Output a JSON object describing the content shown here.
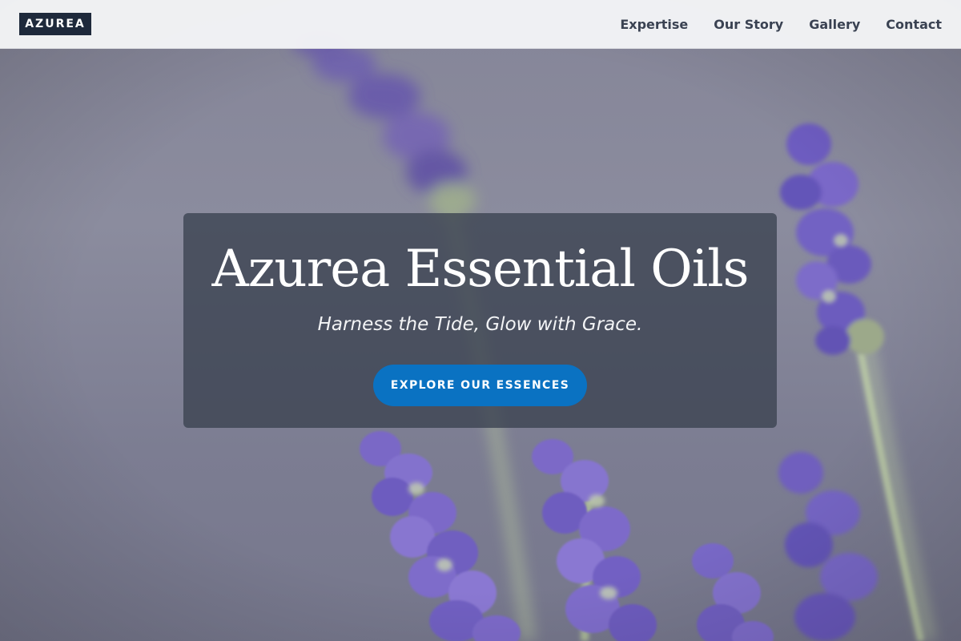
{
  "brand": {
    "logo_text": "AZUREA"
  },
  "nav": {
    "items": [
      {
        "label": "Expertise"
      },
      {
        "label": "Our Story"
      },
      {
        "label": "Gallery"
      },
      {
        "label": "Contact"
      }
    ]
  },
  "hero": {
    "title": "Azurea Essential Oils",
    "tagline": "Harness the Tide, Glow with Grace.",
    "cta_label": "EXPLORE OUR ESSENCES",
    "background": "lavender-flowers-photo"
  },
  "colors": {
    "logo_bg": "#1e293b",
    "cta_bg": "#0a72c2",
    "card_bg": "#3a4150",
    "nav_text": "#3a4252"
  }
}
